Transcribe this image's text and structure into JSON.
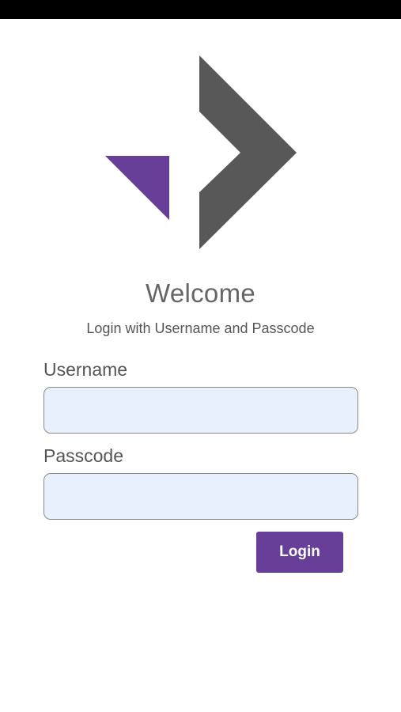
{
  "logo": {
    "icon": "brand-arrow-logo",
    "colors": {
      "triangle": "#673f98",
      "chevron": "#585858"
    }
  },
  "welcome": {
    "title": "Welcome",
    "subtitle": "Login with Username and Passcode"
  },
  "form": {
    "username_label": "Username",
    "username_value": "",
    "passcode_label": "Passcode",
    "passcode_value": "",
    "login_label": "Login"
  },
  "colors": {
    "accent": "#673f98",
    "input_background": "#e8f0fe",
    "status_bar": "#000000"
  }
}
